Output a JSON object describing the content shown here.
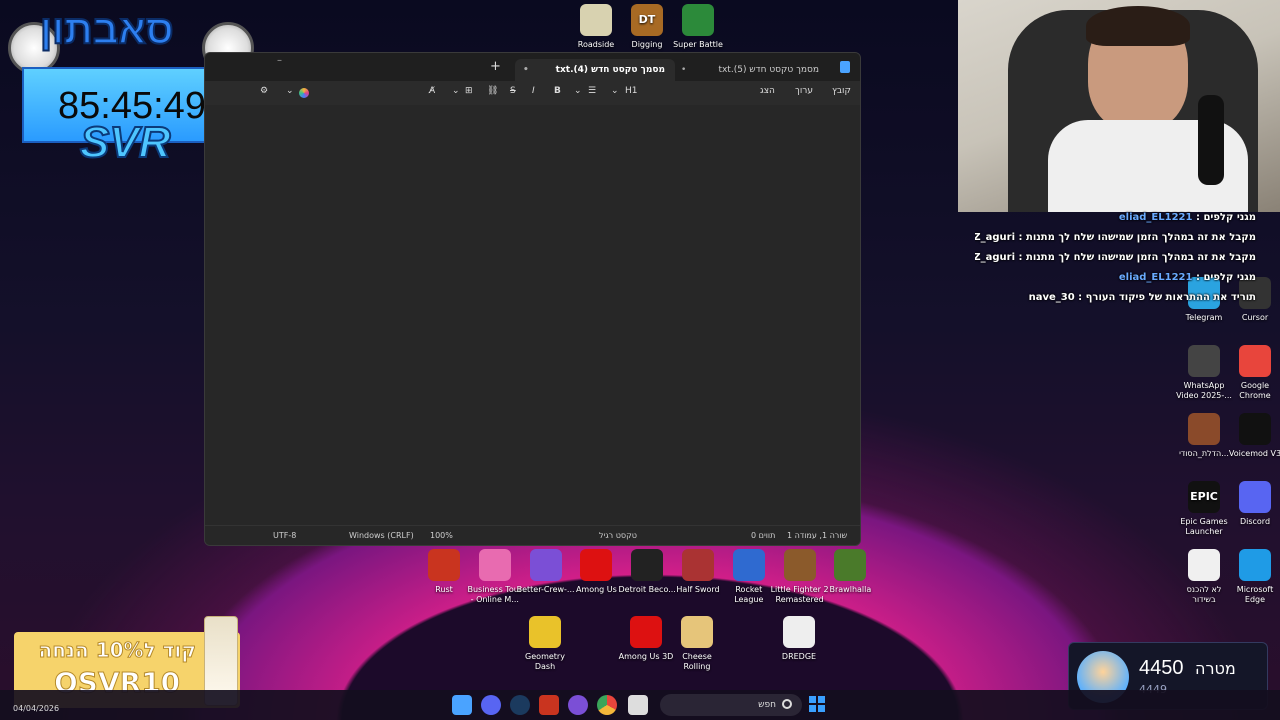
{
  "timer": {
    "title": "סאבתון",
    "value": "85:45:49",
    "tag": "SVR"
  },
  "notepad": {
    "tabs": [
      {
        "label": "מסמך טקסט חדש (4).txt",
        "active": true
      },
      {
        "label": "מסמך טקסט חדש (5).txt",
        "active": false
      }
    ],
    "new_tab": "+",
    "menu": {
      "file": "קובץ",
      "edit": "ערוך",
      "view": "הצג"
    },
    "format": {
      "heading": "H1",
      "bold": "B",
      "italic": "I",
      "strike": "S"
    },
    "status": {
      "position": "שורה 1, עמודה 1",
      "chars": "0 תווים",
      "mode": "טקסט רגיל",
      "zoom": "100%",
      "line_ending": "Windows (CRLF)",
      "encoding": "UTF-8"
    }
  },
  "desktop_top": [
    {
      "label": "Roadside",
      "color": "#d8d2b0"
    },
    {
      "label": "Digging",
      "color": "#a86a24",
      "glyph": "DT"
    },
    {
      "label": "Super Battle",
      "color": "#2c8a3a"
    }
  ],
  "desktop_row1": [
    {
      "label": "Rust",
      "color": "#c9341f"
    },
    {
      "label": "Business Tour - Online M...",
      "color": "#e86bb0"
    },
    {
      "label": "Better-Crew-...",
      "color": "#7b4fd6"
    },
    {
      "label": "Among Us",
      "color": "#d11"
    },
    {
      "label": "Detroit Beco...",
      "color": "#222"
    },
    {
      "label": "Half Sword",
      "color": "#a33"
    },
    {
      "label": "Rocket League",
      "color": "#2f6ad0"
    },
    {
      "label": "Little Fighter 2 Remastered",
      "color": "#8b5a2b"
    },
    {
      "label": "Brawlhalla",
      "color": "#4a7a2a"
    }
  ],
  "desktop_row2": [
    {
      "label": "Geometry Dash",
      "color": "#e9c22a"
    },
    {
      "label": "Among Us 3D",
      "color": "#d11"
    },
    {
      "label": "Cheese Rolling",
      "color": "#e6c57a"
    },
    {
      "label": "DREDGE",
      "color": "#eee"
    }
  ],
  "desktop_right": [
    {
      "label": "Telegram",
      "color": "#2aa3e0"
    },
    {
      "label": "Cursor",
      "color": "#333"
    },
    {
      "label": "WhatsApp Video 2025-...",
      "color": "#444"
    },
    {
      "label": "Google Chrome",
      "color": "#e8453c"
    },
    {
      "label": "הדלת_הסודי...",
      "color": "#8a4a2a"
    },
    {
      "label": "Voicemod V3",
      "color": "#111"
    },
    {
      "label": "Epic Games Launcher",
      "color": "#111",
      "glyph": "EPIC"
    },
    {
      "label": "Discord",
      "color": "#5865f2"
    },
    {
      "label": "לא להכנס בשידור",
      "color": "#f0f0f0"
    },
    {
      "label": "Microsoft Edge",
      "color": "#1f9be6"
    }
  ],
  "chat": [
    {
      "user": "eliad_EL1221",
      "msg": "מגני קלפים",
      "blue": true
    },
    {
      "user": "Z_aguri",
      "msg": "מקבל את זה במהלך הזמן שמישהו שלח לך מתנות",
      "blue": false
    },
    {
      "user": "Z_aguri",
      "msg": "מקבל את זה במהלך הזמן שמישהו שלח לך מתנות",
      "blue": false
    },
    {
      "user": "eliad_EL1221",
      "msg": "מגני קלפים",
      "blue": true
    },
    {
      "user": "nave_30",
      "msg": "תוריד את ההתראות של פיקוד העורף",
      "blue": false
    }
  ],
  "promo": {
    "line1": "קוד ל10% הנחה",
    "line2": "OSVR10"
  },
  "goal": {
    "label": "מטרה",
    "value": "4450",
    "current": "4449"
  },
  "taskbar": {
    "search_placeholder": "חפש",
    "date": "04/04/2026"
  }
}
